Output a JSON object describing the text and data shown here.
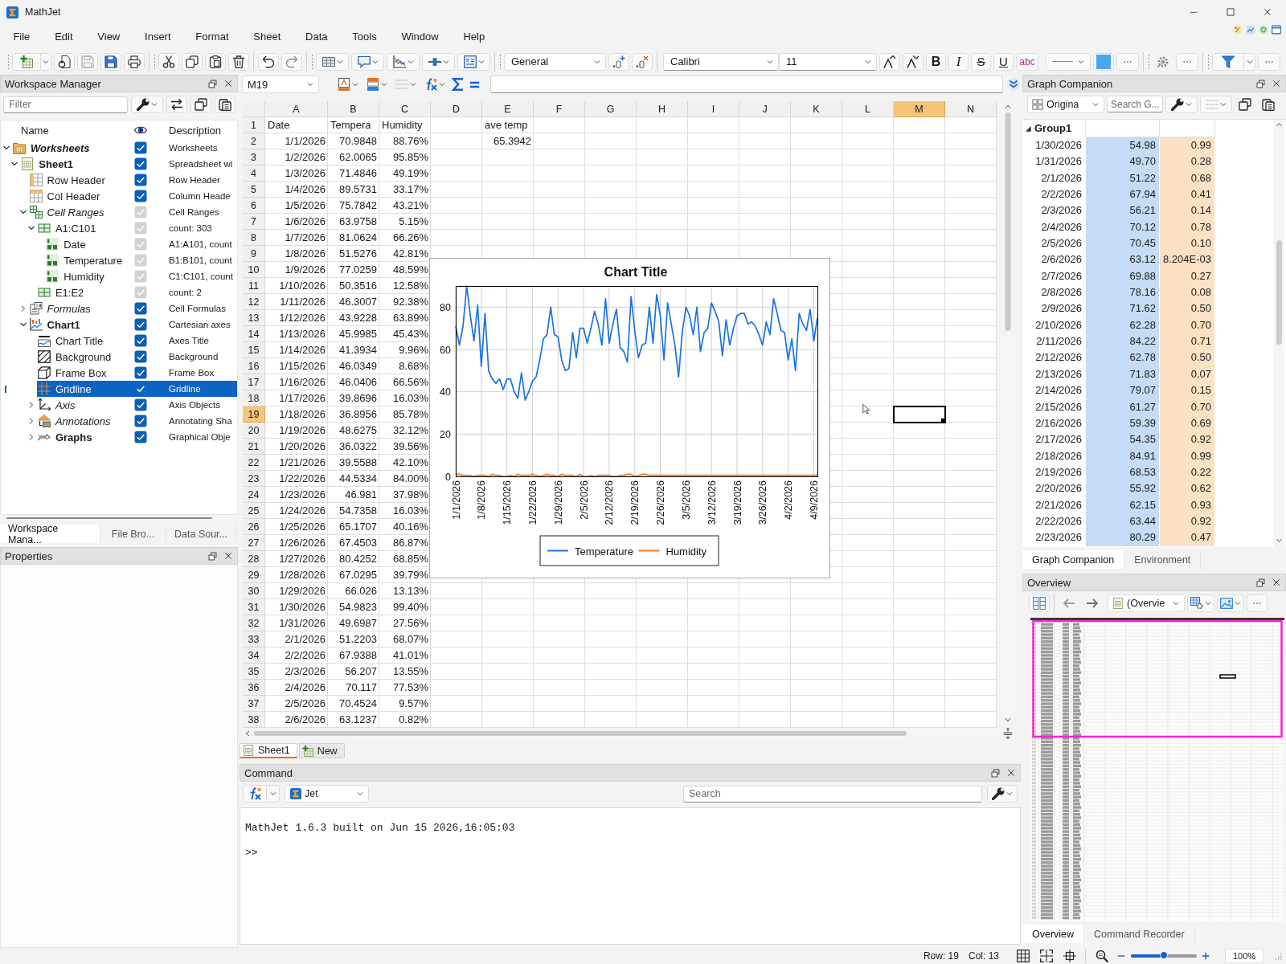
{
  "window": {
    "title": "MathJet"
  },
  "menu": [
    "File",
    "Edit",
    "View",
    "Insert",
    "Format",
    "Sheet",
    "Data",
    "Tools",
    "Window",
    "Help"
  ],
  "toolbar": {
    "number_format": "General",
    "font": "Calibri",
    "font_size": "11",
    "text_styles": [
      "B",
      "I",
      "S",
      "U",
      "abc"
    ]
  },
  "formula_bar": {
    "cell": "M19"
  },
  "workspace": {
    "title": "Workspace Manager",
    "filter_placeholder": "Filter",
    "columns": [
      "Name",
      "Description"
    ],
    "tree": [
      {
        "name": "Worksheets",
        "description": "Worksheets",
        "kind": "root",
        "visible": true,
        "disabled": false,
        "selected": false,
        "expanded": true,
        "children": [
          {
            "name": "Sheet1",
            "description": "Spreadsheet wi",
            "kind": "object",
            "visible": true,
            "disabled": false,
            "selected": false,
            "expanded": true,
            "children": [
              {
                "name": "Row Header",
                "description": "Row Header",
                "kind": "item",
                "visible": true,
                "disabled": false,
                "selected": false
              },
              {
                "name": "Col Header",
                "description": "Column Heade",
                "kind": "item",
                "visible": true,
                "disabled": false,
                "selected": false
              },
              {
                "name": "Cell Ranges",
                "description": "Cell Ranges",
                "kind": "collection",
                "visible": true,
                "disabled": true,
                "selected": false,
                "expanded": true,
                "children": [
                  {
                    "name": "A1:C101",
                    "description": "count: 303",
                    "kind": "item",
                    "visible": true,
                    "disabled": true,
                    "selected": false,
                    "expanded": true,
                    "children": [
                      {
                        "name": "Date",
                        "description": "A1:A101, count",
                        "kind": "item",
                        "visible": true,
                        "disabled": true,
                        "selected": false
                      },
                      {
                        "name": "Temperature",
                        "description": "B1:B101, count",
                        "kind": "item",
                        "visible": true,
                        "disabled": true,
                        "selected": false
                      },
                      {
                        "name": "Humidity",
                        "description": "C1:C101, count",
                        "kind": "item",
                        "visible": true,
                        "disabled": true,
                        "selected": false
                      }
                    ]
                  },
                  {
                    "name": "E1:E2",
                    "description": "count: 2",
                    "kind": "item",
                    "visible": true,
                    "disabled": true,
                    "selected": false
                  }
                ]
              },
              {
                "name": "Formulas",
                "description": "Cell Formulas",
                "kind": "collection",
                "visible": true,
                "disabled": false,
                "selected": false,
                "expanded": false
              },
              {
                "name": "Chart1",
                "description": "Cartesian axes",
                "kind": "object",
                "visible": true,
                "disabled": false,
                "selected": false,
                "expanded": true,
                "children": [
                  {
                    "name": "Chart Title",
                    "description": "Axes Title",
                    "kind": "item",
                    "visible": true,
                    "disabled": false,
                    "selected": false
                  },
                  {
                    "name": "Background",
                    "description": "Background",
                    "kind": "item",
                    "visible": true,
                    "disabled": false,
                    "selected": false
                  },
                  {
                    "name": "Frame Box",
                    "description": "Frame Box",
                    "kind": "item",
                    "visible": true,
                    "disabled": false,
                    "selected": false
                  },
                  {
                    "name": "Gridline",
                    "description": "Gridline",
                    "kind": "item",
                    "visible": true,
                    "disabled": false,
                    "selected": true
                  },
                  {
                    "name": "Axis",
                    "description": "Axis Objects",
                    "kind": "collection",
                    "visible": true,
                    "disabled": false,
                    "selected": false,
                    "expanded": false
                  },
                  {
                    "name": "Annotations",
                    "description": "Annotating Sha",
                    "kind": "collection",
                    "visible": true,
                    "disabled": false,
                    "selected": false,
                    "expanded": false
                  },
                  {
                    "name": "Graphs",
                    "description": "Graphical Obje",
                    "kind": "object",
                    "visible": true,
                    "disabled": false,
                    "selected": false,
                    "expanded": false
                  }
                ]
              }
            ]
          }
        ]
      }
    ],
    "tabs": [
      {
        "label": "Workspace Mana...",
        "selected": true
      },
      {
        "label": "File Bro...",
        "selected": false
      },
      {
        "label": "Data Sour...",
        "selected": false
      }
    ]
  },
  "properties": {
    "title": "Properties"
  },
  "sheet": {
    "columns": [
      {
        "label": "A",
        "selected": false
      },
      {
        "label": "B",
        "selected": false
      },
      {
        "label": "C",
        "selected": false
      },
      {
        "label": "D",
        "selected": false
      },
      {
        "label": "E",
        "selected": false
      },
      {
        "label": "F",
        "selected": false
      },
      {
        "label": "G",
        "selected": false
      },
      {
        "label": "H",
        "selected": false
      },
      {
        "label": "I",
        "selected": false
      },
      {
        "label": "J",
        "selected": false
      },
      {
        "label": "K",
        "selected": false
      },
      {
        "label": "L",
        "selected": false
      },
      {
        "label": "M",
        "selected": true
      },
      {
        "label": "N",
        "selected": false
      }
    ],
    "rows": [
      {
        "label": "1",
        "selected": false,
        "kind": "labels",
        "cells": [
          "Date",
          "Tempera",
          "Humidity"
        ]
      },
      {
        "label": "2",
        "selected": false,
        "kind": "values",
        "cells": [
          "1/1/2026",
          "70.9848",
          "88.76%"
        ]
      },
      {
        "label": "3",
        "selected": false,
        "kind": "values",
        "cells": [
          "1/2/2026",
          "62.0065",
          "95.85%"
        ]
      },
      {
        "label": "4",
        "selected": false,
        "kind": "values",
        "cells": [
          "1/3/2026",
          "71.4846",
          "49.19%"
        ]
      },
      {
        "label": "5",
        "selected": false,
        "kind": "values",
        "cells": [
          "1/4/2026",
          "89.5731",
          "33.17%"
        ]
      },
      {
        "label": "6",
        "selected": false,
        "kind": "values",
        "cells": [
          "1/5/2026",
          "75.7842",
          "43.21%"
        ]
      },
      {
        "label": "7",
        "selected": false,
        "kind": "values",
        "cells": [
          "1/6/2026",
          "63.9758",
          "5.15%"
        ]
      },
      {
        "label": "8",
        "selected": false,
        "kind": "values",
        "cells": [
          "1/7/2026",
          "81.0624",
          "66.26%"
        ]
      },
      {
        "label": "9",
        "selected": false,
        "kind": "values",
        "cells": [
          "1/8/2026",
          "51.5276",
          "42.81%"
        ]
      },
      {
        "label": "10",
        "selected": false,
        "kind": "values",
        "cells": [
          "1/9/2026",
          "77.0259",
          "48.59%"
        ]
      },
      {
        "label": "11",
        "selected": false,
        "kind": "values",
        "cells": [
          "1/10/2026",
          "50.3516",
          "12.58%"
        ]
      },
      {
        "label": "12",
        "selected": false,
        "kind": "values",
        "cells": [
          "1/11/2026",
          "46.3007",
          "92.38%"
        ]
      },
      {
        "label": "13",
        "selected": false,
        "kind": "values",
        "cells": [
          "1/12/2026",
          "43.9228",
          "63.89%"
        ]
      },
      {
        "label": "14",
        "selected": false,
        "kind": "values",
        "cells": [
          "1/13/2026",
          "45.9985",
          "45.43%"
        ]
      },
      {
        "label": "15",
        "selected": false,
        "kind": "values",
        "cells": [
          "1/14/2026",
          "41.3934",
          "9.96%"
        ]
      },
      {
        "label": "16",
        "selected": false,
        "kind": "values",
        "cells": [
          "1/15/2026",
          "46.0349",
          "8.68%"
        ]
      },
      {
        "label": "17",
        "selected": false,
        "kind": "values",
        "cells": [
          "1/16/2026",
          "46.0406",
          "66.56%"
        ]
      },
      {
        "label": "18",
        "selected": false,
        "kind": "values",
        "cells": [
          "1/17/2026",
          "39.8696",
          "16.03%"
        ]
      },
      {
        "label": "19",
        "selected": true,
        "kind": "values",
        "cells": [
          "1/18/2026",
          "36.8956",
          "85.78%"
        ]
      },
      {
        "label": "20",
        "selected": false,
        "kind": "values",
        "cells": [
          "1/19/2026",
          "48.6275",
          "32.12%"
        ]
      },
      {
        "label": "21",
        "selected": false,
        "kind": "values",
        "cells": [
          "1/20/2026",
          "36.0322",
          "39.56%"
        ]
      },
      {
        "label": "22",
        "selected": false,
        "kind": "values",
        "cells": [
          "1/21/2026",
          "39.5588",
          "42.10%"
        ]
      },
      {
        "label": "23",
        "selected": false,
        "kind": "values",
        "cells": [
          "1/22/2026",
          "44.5334",
          "84.00%"
        ]
      },
      {
        "label": "24",
        "selected": false,
        "kind": "values",
        "cells": [
          "1/23/2026",
          "46.981",
          "37.98%"
        ]
      },
      {
        "label": "25",
        "selected": false,
        "kind": "values",
        "cells": [
          "1/24/2026",
          "54.7358",
          "16.03%"
        ]
      },
      {
        "label": "26",
        "selected": false,
        "kind": "values",
        "cells": [
          "1/25/2026",
          "65.1707",
          "40.16%"
        ]
      },
      {
        "label": "27",
        "selected": false,
        "kind": "values",
        "cells": [
          "1/26/2026",
          "67.4503",
          "86.87%"
        ]
      },
      {
        "label": "28",
        "selected": false,
        "kind": "values",
        "cells": [
          "1/27/2026",
          "80.4252",
          "68.85%"
        ]
      },
      {
        "label": "29",
        "selected": false,
        "kind": "values",
        "cells": [
          "1/28/2026",
          "67.0295",
          "39.79%"
        ]
      },
      {
        "label": "30",
        "selected": false,
        "kind": "values",
        "cells": [
          "1/29/2026",
          "66.026",
          "13.13%"
        ]
      },
      {
        "label": "31",
        "selected": false,
        "kind": "values",
        "cells": [
          "1/30/2026",
          "54.9823",
          "99.40%"
        ]
      },
      {
        "label": "32",
        "selected": false,
        "kind": "values",
        "cells": [
          "1/31/2026",
          "49.6987",
          "27.56%"
        ]
      },
      {
        "label": "33",
        "selected": false,
        "kind": "values",
        "cells": [
          "2/1/2026",
          "51.2203",
          "68.07%"
        ]
      },
      {
        "label": "34",
        "selected": false,
        "kind": "values",
        "cells": [
          "2/2/2026",
          "67.9388",
          "41.01%"
        ]
      },
      {
        "label": "35",
        "selected": false,
        "kind": "values",
        "cells": [
          "2/3/2026",
          "56.207",
          "13.55%"
        ]
      },
      {
        "label": "36",
        "selected": false,
        "kind": "values",
        "cells": [
          "2/4/2026",
          "70.117",
          "77.53%"
        ]
      },
      {
        "label": "37",
        "selected": false,
        "kind": "values",
        "cells": [
          "2/5/2026",
          "70.4524",
          "9.57%"
        ]
      },
      {
        "label": "38",
        "selected": false,
        "kind": "values",
        "cells": [
          "2/6/2026",
          "63.1237",
          "0.82%"
        ]
      }
    ],
    "side_block": {
      "heading": "ave temp",
      "value": "65.3942"
    },
    "chart": {
      "chart_data": {
        "type": "line",
        "title": "Chart Title",
        "grid": true,
        "legend": true,
        "categories": [
          "1/1/2026",
          null,
          null,
          null,
          null,
          null,
          null,
          "1/8/2026",
          null,
          null,
          null,
          null,
          null,
          null,
          "1/15/2026",
          null,
          null,
          null,
          null,
          null,
          null,
          "1/22/2026",
          null,
          null,
          null,
          null,
          null,
          null,
          "1/29/2026",
          null,
          null,
          null,
          null,
          null,
          null,
          "2/5/2026",
          null,
          null,
          null,
          null,
          null,
          null,
          "2/12/2026",
          null,
          null,
          null,
          null,
          null,
          null,
          "2/19/2026",
          null,
          null,
          null,
          null,
          null,
          null,
          "2/26/2026",
          null,
          null,
          null,
          null,
          null,
          null,
          "3/5/2026",
          null,
          null,
          null,
          null,
          null,
          null,
          "3/12/2026",
          null,
          null,
          null,
          null,
          null,
          null,
          "3/19/2026",
          null,
          null,
          null,
          null,
          null,
          null,
          "3/26/2026",
          null,
          null,
          null,
          null,
          null,
          null,
          "4/2/2026",
          null,
          null,
          null,
          null,
          null,
          null,
          "4/9/2026",
          null
        ],
        "ylim": [
          0,
          90
        ],
        "yticks": [
          0,
          20,
          40,
          60,
          80
        ],
        "series": [
          {
            "name": "Temperature",
            "color": "#1a73e0",
            "values": [
              71,
              62,
              71,
              90,
              76,
              64,
              81,
              52,
              77,
              50,
              46,
              44,
              46,
              41,
              46,
              46,
              40,
              37,
              49,
              36,
              40,
              45,
              47,
              55,
              65,
              67,
              80,
              67,
              66,
              55,
              50,
              51,
              68,
              56,
              70,
              70,
              63,
              70,
              78,
              72,
              62,
              84,
              63,
              72,
              79,
              61,
              59,
              54,
              85,
              69,
              56,
              62,
              63,
              80,
              63,
              86,
              76,
              55,
              82,
              72,
              62,
              47,
              68,
              80,
              76,
              67,
              80,
              59,
              68,
              70,
              82,
              78,
              73,
              57,
              74,
              62,
              70,
              76,
              77,
              77,
              72,
              73,
              71,
              67,
              62,
              73,
              67,
              84,
              77,
              69,
              68,
              55,
              65,
              50,
              77,
              72,
              69,
              79,
              64,
              75
            ]
          },
          {
            "name": "Humidity",
            "color": "#f07c1c",
            "values": [
              1,
              1,
              0.5,
              0.5,
              0.5,
              0,
              0.5,
              0.5,
              0.5,
              0,
              1,
              0.5,
              0.5,
              0,
              0,
              0.5,
              0,
              1,
              0.5,
              0.5,
              0.5,
              1,
              0.5,
              0,
              0.5,
              1,
              0.5,
              0.5,
              0,
              1,
              0.5,
              0.5,
              0.5,
              0,
              1,
              0,
              0,
              0.5,
              0,
              0.5,
              0.5,
              0.5,
              0.5,
              0,
              0,
              0.5,
              0.5,
              1,
              1,
              0,
              0.5,
              1,
              1,
              0.5,
              0.5,
              0.5,
              0.5,
              0.5,
              0.5,
              0.5,
              0.5,
              0.5,
              0.5,
              0.5,
              0.5,
              0.5,
              0.5,
              0.5,
              0.5,
              0.5,
              0.5,
              0.5,
              0.5,
              0.5,
              0.5,
              0.5,
              0.5,
              0.5,
              0.5,
              0.5,
              0.5,
              0.5,
              0.5,
              0.5,
              0.5,
              0.5,
              0.5,
              0.5,
              0.5,
              0.5,
              0.5,
              0.5,
              0.5,
              0.5,
              0.5,
              0.5,
              0.5,
              0.5,
              0.5,
              0.5
            ]
          }
        ]
      }
    },
    "tabs": [
      {
        "label": "Sheet1",
        "kind": "sheet",
        "selected": true
      },
      {
        "label": "New",
        "kind": "add",
        "selected": false
      }
    ]
  },
  "command": {
    "title": "Command",
    "engine": "Jet",
    "search_placeholder": "Search",
    "output": [
      "MathJet 1.6.3 built on Jun 15 2026,16:05:03",
      ">>"
    ]
  },
  "graph_companion": {
    "title": "Graph Companion",
    "source": "Origina",
    "search_placeholder": "Search G...",
    "group": "Group1",
    "expanded": true,
    "columns": [
      {
        "color": "#c4dcf5"
      },
      {
        "color": "#fde1c4"
      }
    ],
    "rows": [
      {
        "date": "1/30/2026",
        "values": [
          "54.98",
          "0.99"
        ]
      },
      {
        "date": "1/31/2026",
        "values": [
          "49.70",
          "0.28"
        ]
      },
      {
        "date": "2/1/2026",
        "values": [
          "51.22",
          "0.68"
        ]
      },
      {
        "date": "2/2/2026",
        "values": [
          "67.94",
          "0.41"
        ]
      },
      {
        "date": "2/3/2026",
        "values": [
          "56.21",
          "0.14"
        ]
      },
      {
        "date": "2/4/2026",
        "values": [
          "70.12",
          "0.78"
        ]
      },
      {
        "date": "2/5/2026",
        "values": [
          "70.45",
          "0.10"
        ]
      },
      {
        "date": "2/6/2026",
        "values": [
          "63.12",
          "8.204E-03"
        ]
      },
      {
        "date": "2/7/2026",
        "values": [
          "69.88",
          "0.27"
        ]
      },
      {
        "date": "2/8/2026",
        "values": [
          "78.16",
          "0.08"
        ]
      },
      {
        "date": "2/9/2026",
        "values": [
          "71.62",
          "0.50"
        ]
      },
      {
        "date": "2/10/2026",
        "values": [
          "62.28",
          "0.70"
        ]
      },
      {
        "date": "2/11/2026",
        "values": [
          "84.22",
          "0.71"
        ]
      },
      {
        "date": "2/12/2026",
        "values": [
          "62.78",
          "0.50"
        ]
      },
      {
        "date": "2/13/2026",
        "values": [
          "71.83",
          "0.07"
        ]
      },
      {
        "date": "2/14/2026",
        "values": [
          "79.07",
          "0.15"
        ]
      },
      {
        "date": "2/15/2026",
        "values": [
          "61.27",
          "0.70"
        ]
      },
      {
        "date": "2/16/2026",
        "values": [
          "59.39",
          "0.69"
        ]
      },
      {
        "date": "2/17/2026",
        "values": [
          "54.35",
          "0.92"
        ]
      },
      {
        "date": "2/18/2026",
        "values": [
          "84.91",
          "0.99"
        ]
      },
      {
        "date": "2/19/2026",
        "values": [
          "68.53",
          "0.22"
        ]
      },
      {
        "date": "2/20/2026",
        "values": [
          "55.92",
          "0.62"
        ]
      },
      {
        "date": "2/21/2026",
        "values": [
          "62.15",
          "0.93"
        ]
      },
      {
        "date": "2/22/2026",
        "values": [
          "63.44",
          "0.92"
        ]
      },
      {
        "date": "2/23/2026",
        "values": [
          "80.29",
          "0.47"
        ]
      }
    ],
    "tabs": [
      {
        "label": "Graph Companion",
        "selected": true
      },
      {
        "label": "Environment",
        "selected": false
      }
    ]
  },
  "overview": {
    "title": "Overview",
    "view": "(Overvie",
    "tabs": [
      {
        "label": "Overview",
        "selected": true
      },
      {
        "label": "Command Recorder",
        "selected": false
      }
    ]
  },
  "status_bar": {
    "row": "Row: 19",
    "col": "Col: 13",
    "zoom": {
      "level": 0.5,
      "reading": "100%"
    }
  }
}
